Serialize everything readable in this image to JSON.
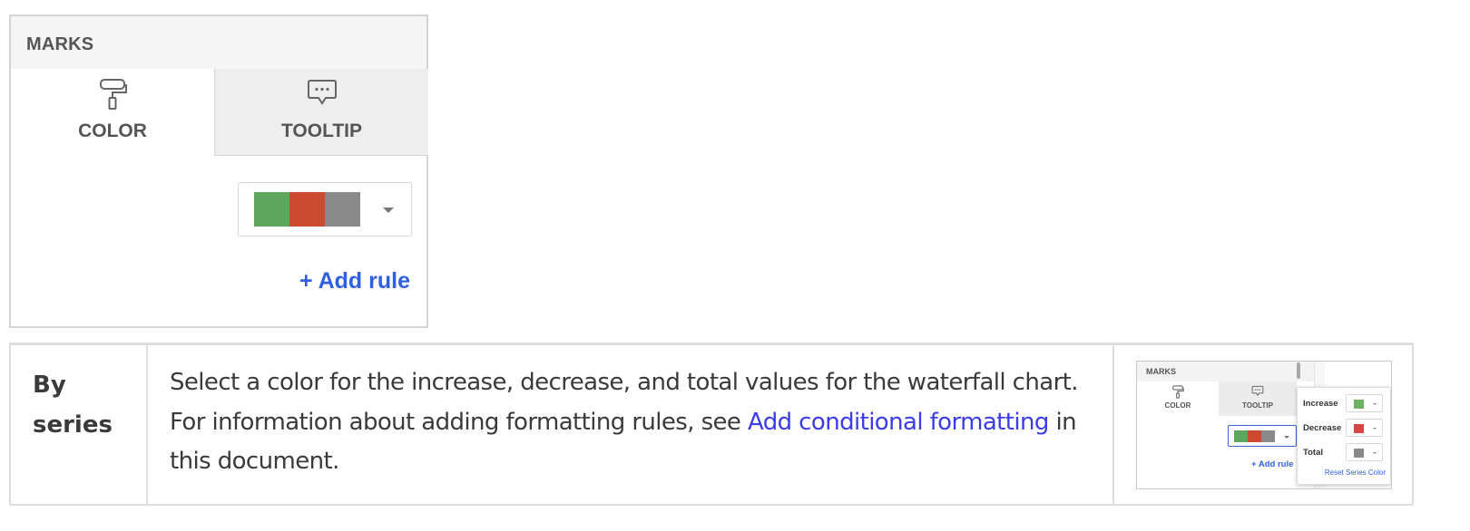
{
  "marks_panel": {
    "header": "MARKS",
    "tabs": [
      {
        "label": "COLOR",
        "icon": "paint-roller-icon",
        "active": true
      },
      {
        "label": "TOOLTIP",
        "icon": "speech-bubble-icon",
        "active": false
      }
    ],
    "palette_colors": [
      "#5ea65e",
      "#cc4b30",
      "#8a8a8a"
    ],
    "add_rule_label": "+ Add rule"
  },
  "table": {
    "row_label": "By series",
    "description_part1": "Select a color for the increase, decrease, and total values for the waterfall chart. For information about adding formatting rules, see ",
    "link_text": "Add conditional formatting",
    "description_part2": " in this document."
  },
  "thumbnail": {
    "header": "MARKS",
    "tabs": [
      "COLOR",
      "TOOLTIP"
    ],
    "add_rule_label": "+ Add rule",
    "series": [
      {
        "name": "Increase",
        "color": "#6cb35f"
      },
      {
        "name": "Decrease",
        "color": "#d64646"
      },
      {
        "name": "Total",
        "color": "#8a8a8a"
      }
    ],
    "reset_label": "Reset Series Color"
  },
  "colors": {
    "link": "#3b3be8",
    "accent_blue": "#2f5fe3"
  }
}
